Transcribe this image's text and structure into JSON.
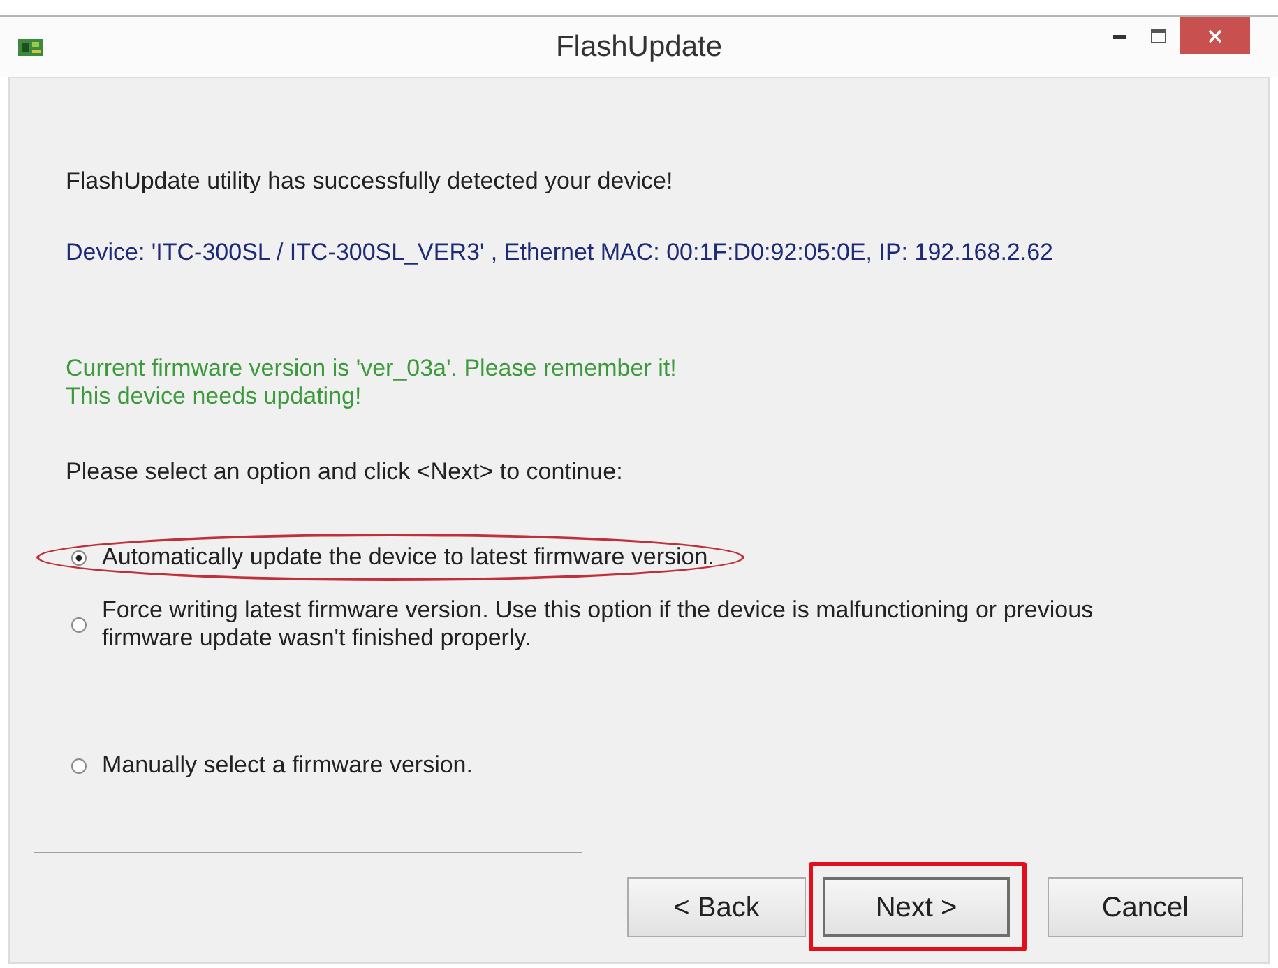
{
  "window": {
    "title": "FlashUpdate"
  },
  "intro": "FlashUpdate utility has successfully detected your device!",
  "device_info": "Device: 'ITC-300SL / ITC-300SL_VER3' , Ethernet MAC: 00:1F:D0:92:05:0E, IP: 192.168.2.62",
  "status_lines": [
    "Current firmware version is 'ver_03a'. Please remember it!",
    "This device needs updating!"
  ],
  "prompt": "Please select an option and click <Next> to continue:",
  "options": [
    {
      "label": "Automatically update the device to latest firmware version.",
      "selected": true,
      "highlighted": true
    },
    {
      "label": "Force writing latest firmware version. Use this option if the device is malfunctioning or previous firmware update wasn't finished properly.",
      "selected": false,
      "highlighted": false
    },
    {
      "label": "Manually select a firmware version.",
      "selected": false,
      "highlighted": false
    }
  ],
  "buttons": [
    {
      "label": "< Back",
      "default": false,
      "highlighted": false
    },
    {
      "label": "Next >",
      "default": true,
      "highlighted": true
    },
    {
      "label": "Cancel",
      "default": false,
      "highlighted": false
    }
  ]
}
